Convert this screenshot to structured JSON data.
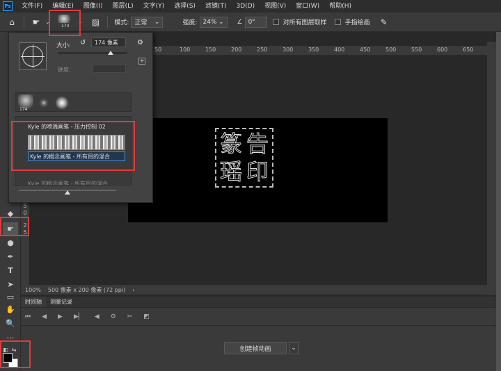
{
  "menu": {
    "logo": "Ps",
    "items": [
      "文件(F)",
      "编辑(E)",
      "图像(I)",
      "图层(L)",
      "文字(Y)",
      "选择(S)",
      "滤镜(T)",
      "3D(D)",
      "视图(V)",
      "窗口(W)",
      "帮助(H)"
    ]
  },
  "options": {
    "preset_size": "174",
    "mode_label": "模式:",
    "mode_value": "正常",
    "strength_label": "强度:",
    "strength_value": "24%",
    "angle_value": "0°",
    "sample_all_label": "对所有图层取样",
    "finger_paint_label": "手指绘画"
  },
  "brush_panel": {
    "size_label": "大小:",
    "size_value": "174 像素",
    "hardness_label": "硬度:",
    "thumb_size": "174",
    "items": [
      {
        "label": "Kyle 的喷溅画笔 - 压力控制 02"
      },
      {
        "label": "Kyle 的概念画笔 - 所有目的混合"
      },
      {
        "label": "Kyle 的概念画笔 - 所有目的混合"
      }
    ]
  },
  "ruler": {
    "top_ticks": [
      "50",
      "100",
      "150",
      "200",
      "250",
      "300",
      "350",
      "400",
      "450",
      "500",
      "550",
      "600",
      "650"
    ],
    "left_ticks": [
      "5",
      "0",
      "2",
      "5"
    ]
  },
  "canvas": {
    "seal_chars": [
      "篆",
      "告",
      "瑶",
      "印"
    ]
  },
  "status": {
    "zoom": "100%",
    "doc_info": "500 像素 x 200 像素 (72 ppi)"
  },
  "timeline": {
    "tab_timeline": "时间轴",
    "tab_measure": "测量记录",
    "create_button": "创建帧动画"
  },
  "colors": {
    "highlight": "#e23b3b",
    "selection": "#4a90d9"
  }
}
